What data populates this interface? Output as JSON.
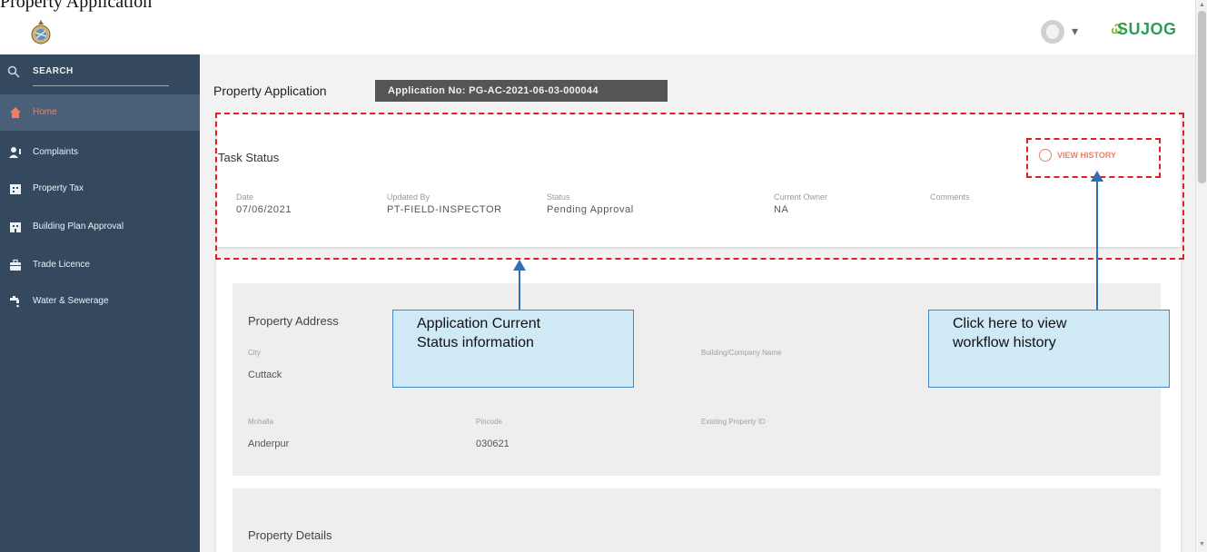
{
  "top_caption": "Property Application",
  "header": {
    "brand": "SUJOG",
    "brand_mark": "Ꮗ",
    "avatar_caret": "▾"
  },
  "sidebar": {
    "search_label": "SEARCH",
    "items": [
      {
        "label": "Home",
        "icon": "home-icon",
        "active": true
      },
      {
        "label": "Complaints",
        "icon": "complaints-icon",
        "active": false
      },
      {
        "label": "Property Tax",
        "icon": "property-tax-icon",
        "active": false
      },
      {
        "label": "Building Plan Approval",
        "icon": "building-icon",
        "active": false
      },
      {
        "label": "Trade Licence",
        "icon": "briefcase-icon",
        "active": false
      },
      {
        "label": "Water & Sewerage",
        "icon": "water-tap-icon",
        "active": false
      }
    ]
  },
  "main": {
    "page_title": "Property Application",
    "application_no": "Application No: PG-AC-2021-06-03-000044",
    "task_status": {
      "title": "Task Status",
      "view_history": "VIEW HISTORY",
      "fields": [
        {
          "label": "Date",
          "value": "07/06/2021"
        },
        {
          "label": "Updated By",
          "value": "PT-FIELD-INSPECTOR"
        },
        {
          "label": "Status",
          "value": "Pending Approval"
        },
        {
          "label": "Current Owner",
          "value": "NA"
        },
        {
          "label": "Comments",
          "value": ""
        }
      ]
    },
    "property_address": {
      "title": "Property Address",
      "fields": [
        {
          "label": "City",
          "value": "Cuttack"
        },
        {
          "label": "Building/Company Name",
          "value": ""
        },
        {
          "label": "Mohalla",
          "value": "Anderpur"
        },
        {
          "label": "Pincode",
          "value": "030621"
        },
        {
          "label": "Existing Property ID",
          "value": ""
        }
      ]
    },
    "property_details": {
      "title": "Property Details"
    }
  },
  "annotations": {
    "callout_status": [
      "Application Current",
      "Status information"
    ],
    "callout_history": [
      "Click here to view",
      "workflow history"
    ]
  },
  "colors": {
    "sidebar_bg": "#34495e",
    "sidebar_active": "#4a6079",
    "accent": "#f08060",
    "badge_bg": "#555555",
    "brand": "#2f9e55",
    "annotation_border": "#e02020",
    "callout_bg": "#cfe9f7",
    "callout_border": "#4a86c8"
  }
}
